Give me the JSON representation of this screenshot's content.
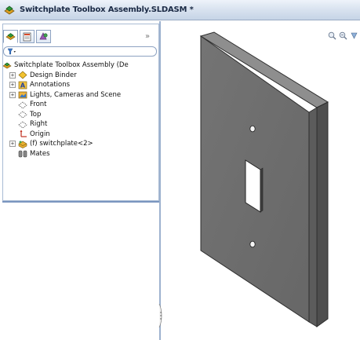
{
  "window": {
    "title": "Switchplate Toolbox  Assembly.SLDASM *"
  },
  "panel": {
    "tabs": [
      {
        "name": "feature-manager",
        "active": true
      },
      {
        "name": "property-manager",
        "active": false
      },
      {
        "name": "configuration-manager",
        "active": false
      }
    ],
    "expand_glyph": "»",
    "filter_icon": "filter-icon"
  },
  "tree": {
    "root_label": "Switchplate Toolbox  Assembly  (De",
    "items": [
      {
        "label": "Design Binder",
        "icon": "design-binder-icon",
        "expandable": true
      },
      {
        "label": "Annotations",
        "icon": "annotations-icon",
        "expandable": true
      },
      {
        "label": "Lights, Cameras and Scene",
        "icon": "lights-cameras-icon",
        "expandable": true
      },
      {
        "label": "Front",
        "icon": "plane-icon",
        "expandable": false
      },
      {
        "label": "Top",
        "icon": "plane-icon",
        "expandable": false
      },
      {
        "label": "Right",
        "icon": "plane-icon",
        "expandable": false
      },
      {
        "label": "Origin",
        "icon": "origin-icon",
        "expandable": false
      },
      {
        "label": "(f) switchplate<2>",
        "icon": "part-icon",
        "expandable": true
      },
      {
        "label": "Mates",
        "icon": "mates-icon",
        "expandable": false
      }
    ]
  },
  "colors": {
    "title_text": "#1b2a45",
    "panel_border": "#9db2cf",
    "plate_face": "#6e6e6e",
    "plate_dark": "#4a4a4a",
    "plate_light": "#8c8c8c"
  },
  "view_tools": [
    "zoom-to-fit-icon",
    "zoom-area-icon",
    "view-orientation-icon"
  ]
}
